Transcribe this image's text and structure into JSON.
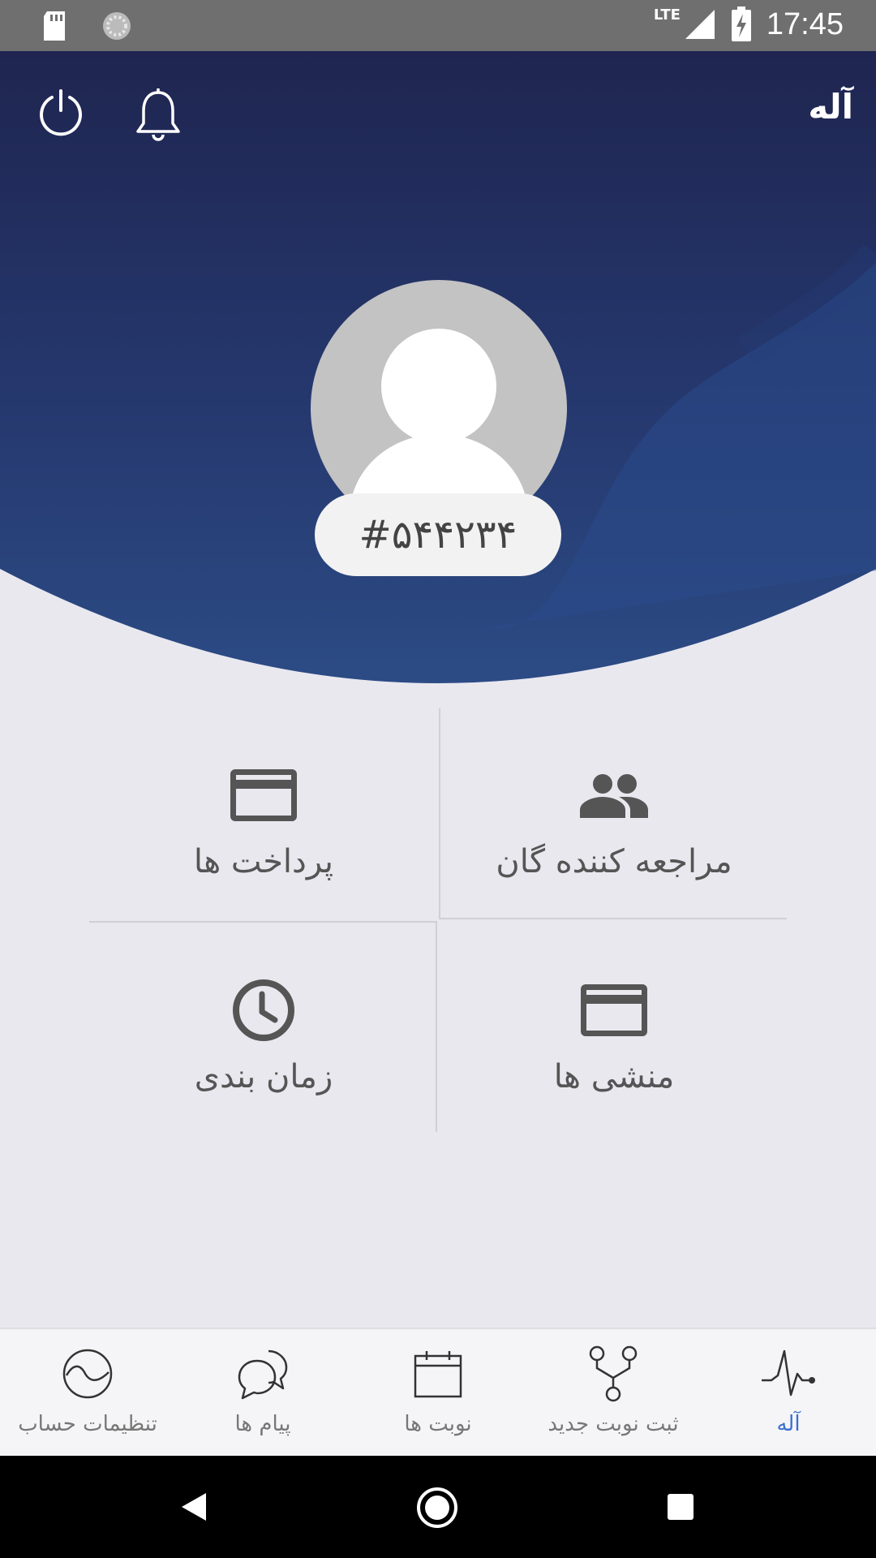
{
  "status_bar": {
    "time": "17:45",
    "network": "LTE",
    "icons": [
      "sd-card-icon",
      "sync-icon",
      "signal-icon",
      "battery-charging-icon"
    ]
  },
  "header": {
    "app_title": "آله",
    "icons": [
      "power-icon",
      "bell-icon"
    ]
  },
  "profile": {
    "avatar": "default-user-avatar",
    "code": "#۵۴۴۲۳۴"
  },
  "menu": {
    "tiles": [
      {
        "label": "مراجعه کننده گان",
        "icon": "people-icon"
      },
      {
        "label": "پرداخت ها",
        "icon": "credit-card-icon"
      },
      {
        "label": "منشی ها",
        "icon": "credit-card-icon"
      },
      {
        "label": "زمان بندی",
        "icon": "clock-icon"
      }
    ]
  },
  "bottom_nav": {
    "items": [
      {
        "label": "آله",
        "icon": "pulse-icon",
        "active": true
      },
      {
        "label": "ثبت نوبت جدید",
        "icon": "branch-icon",
        "active": false
      },
      {
        "label": "نوبت ها",
        "icon": "calendar-icon",
        "active": false
      },
      {
        "label": "پیام ها",
        "icon": "chat-icon",
        "active": false
      },
      {
        "label": "تنظیمات حساب",
        "icon": "wave-circle-icon",
        "active": false
      }
    ]
  },
  "colors": {
    "header_dark": "#1f2550",
    "header_mid": "#27407a",
    "accent": "#3a6fd0",
    "background": "#e9e8ef"
  }
}
